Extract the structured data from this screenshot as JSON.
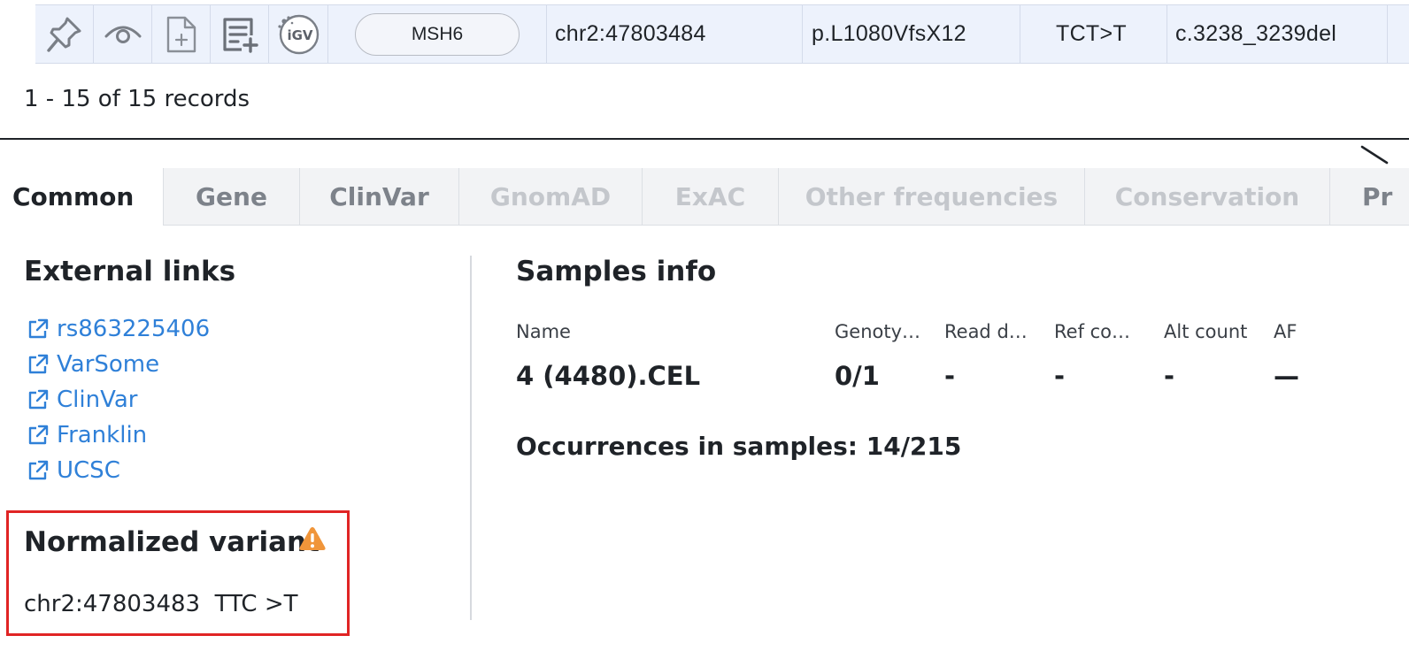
{
  "variant_row": {
    "gene": "MSH6",
    "position": "chr2:47803484",
    "protein_change": "p.L1080VfsX12",
    "ref_alt": "TCT>T",
    "cdna_change": "c.3238_3239del",
    "igv_label": "iGV",
    "icons": [
      "pin-icon",
      "eye-icon",
      "add-document-icon",
      "add-to-list-icon",
      "igv-icon"
    ]
  },
  "pagination": {
    "summary": "1 - 15 of 15 records"
  },
  "tabs": [
    {
      "label": "Common",
      "state": "active"
    },
    {
      "label": "Gene",
      "state": "enabled"
    },
    {
      "label": "ClinVar",
      "state": "enabled"
    },
    {
      "label": "GnomAD",
      "state": "disabled"
    },
    {
      "label": "ExAC",
      "state": "disabled"
    },
    {
      "label": "Other frequencies",
      "state": "disabled"
    },
    {
      "label": "Conservation",
      "state": "disabled"
    },
    {
      "label": "Pr",
      "state": "enabled"
    }
  ],
  "external_links": {
    "title": "External links",
    "items": [
      "rs863225406",
      "VarSome",
      "ClinVar",
      "Franklin",
      "UCSC"
    ]
  },
  "normalized_variant": {
    "title": "Normalized variant",
    "position": "chr2:47803483",
    "change": "TTC >T"
  },
  "samples_info": {
    "title": "Samples info",
    "columns": [
      "Name",
      "Genoty…",
      "Read d…",
      "Ref co…",
      "Alt count",
      "AF"
    ],
    "rows": [
      [
        "4 (4480).CEL",
        "0/1",
        "-",
        "-",
        "-",
        "—"
      ]
    ],
    "occurrences": "Occurrences in samples: 14/215"
  },
  "colors": {
    "row_highlight": "#edf2fc",
    "link": "#2f80d8",
    "warning": "#f0953a",
    "highlight_border": "#e02424"
  }
}
